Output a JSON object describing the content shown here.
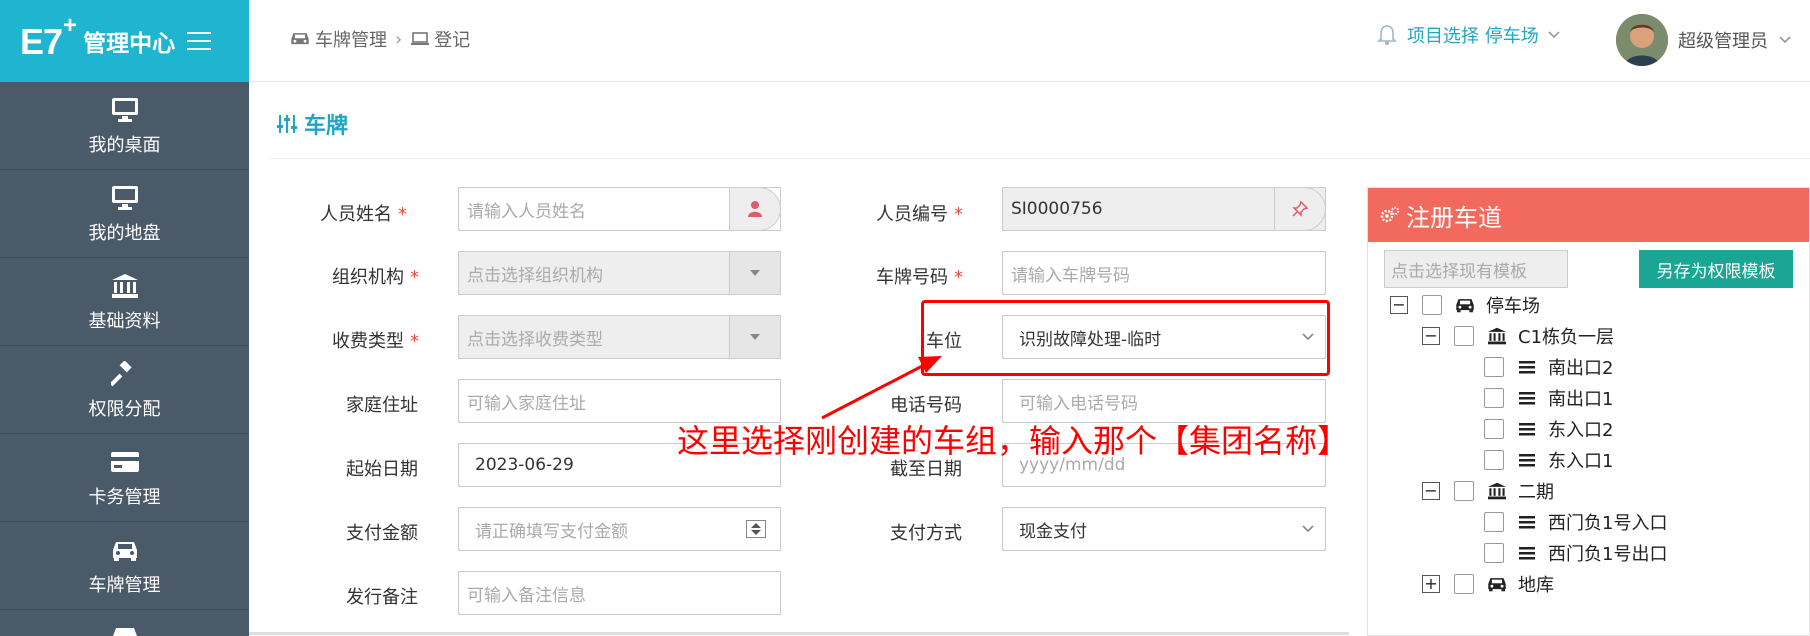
{
  "brand": {
    "logo": "E7",
    "logo_sup": "+",
    "title": "管理中心"
  },
  "sidebar": {
    "items": [
      {
        "label": "我的桌面",
        "icon": "monitor-icon"
      },
      {
        "label": "我的地盘",
        "icon": "monitor-icon"
      },
      {
        "label": "基础资料",
        "icon": "bank-icon"
      },
      {
        "label": "权限分配",
        "icon": "gavel-icon"
      },
      {
        "label": "卡务管理",
        "icon": "card-icon"
      },
      {
        "label": "车牌管理",
        "icon": "car-icon"
      }
    ]
  },
  "header": {
    "breadcrumb": [
      {
        "label": "车牌管理",
        "icon": "car-icon"
      },
      {
        "label": "登记",
        "icon": "laptop-icon"
      }
    ],
    "project_label": "项目选择 停车场",
    "user_name": "超级管理员"
  },
  "section": {
    "title": "车牌"
  },
  "form": {
    "name_label": "人员姓名",
    "name_placeholder": "请输入人员姓名",
    "number_label": "人员编号",
    "number_value": "SI0000756",
    "org_label": "组织机构",
    "org_placeholder": "点击选择组织机构",
    "plate_label": "车牌号码",
    "plate_placeholder": "请输入车牌号码",
    "fee_label": "收费类型",
    "fee_placeholder": "点击选择收费类型",
    "slot_label": "车位",
    "slot_value": "识别故障处理-临时",
    "address_label": "家庭住址",
    "address_placeholder": "可输入家庭住址",
    "phone_label": "电话号码",
    "phone_placeholder": "可输入电话号码",
    "start_label": "起始日期",
    "start_value": "2023-06-29",
    "end_label": "截至日期",
    "end_placeholder": "yyyy/mm/dd",
    "amount_label": "支付金额",
    "amount_placeholder": "请正确填写支付金额",
    "paymethod_label": "支付方式",
    "paymethod_value": "现金支付",
    "remark_label": "发行备注",
    "remark_placeholder": "可输入备注信息",
    "required_mark": "*"
  },
  "annotation": {
    "text": "这里选择刚创建的车组，输入那个【集团名称】"
  },
  "panel": {
    "title": "注册车道",
    "template_placeholder": "点击选择现有模板",
    "save_label": "另存为权限模板",
    "tree": [
      {
        "label": "停车场",
        "icon": "car-icon",
        "expander": "−"
      },
      {
        "label": "C1栋负一层",
        "icon": "bank-icon",
        "expander": "−"
      },
      {
        "label": "南出口2",
        "icon": "list-icon"
      },
      {
        "label": "南出口1",
        "icon": "list-icon"
      },
      {
        "label": "东入口2",
        "icon": "list-icon"
      },
      {
        "label": "东入口1",
        "icon": "list-icon"
      },
      {
        "label": "二期",
        "icon": "bank-icon",
        "expander": "−"
      },
      {
        "label": "西门负1号入口",
        "icon": "list-icon"
      },
      {
        "label": "西门负1号出口",
        "icon": "list-icon"
      },
      {
        "label": "地库",
        "icon": "car-icon",
        "expander": "+"
      }
    ]
  },
  "colors": {
    "brand": "#1fb5d0",
    "sidebar": "#4b5a69",
    "accent": "#1fa6c4",
    "panel_head": "#f26a5d",
    "save_button": "#1ba594",
    "annotation": "#ff0000"
  }
}
